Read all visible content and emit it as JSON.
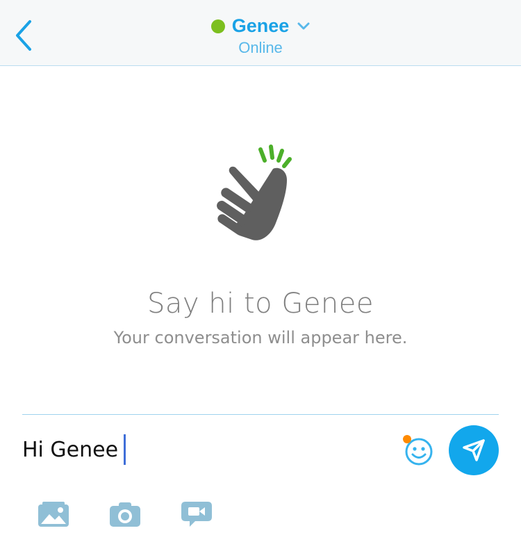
{
  "header": {
    "contact_name": "Genee",
    "status": "Online",
    "presence_color": "#7cbf1f",
    "back_icon": "chevron-left-icon",
    "dropdown_icon": "chevron-down-icon"
  },
  "empty_state": {
    "icon": "snap-fingers-icon",
    "title": "Say hi to Genee",
    "subtitle": "Your conversation will appear here."
  },
  "composer": {
    "input_value": "Hi Genee",
    "emoji_icon": "emoji-smile-icon",
    "send_icon": "send-icon"
  },
  "toolbar": {
    "items": [
      {
        "icon": "photo-gallery-icon"
      },
      {
        "icon": "camera-icon"
      },
      {
        "icon": "video-message-icon"
      }
    ]
  },
  "colors": {
    "accent": "#12a7ec",
    "text_muted": "#7f7f7f",
    "icon_muted": "#90bfd6"
  }
}
